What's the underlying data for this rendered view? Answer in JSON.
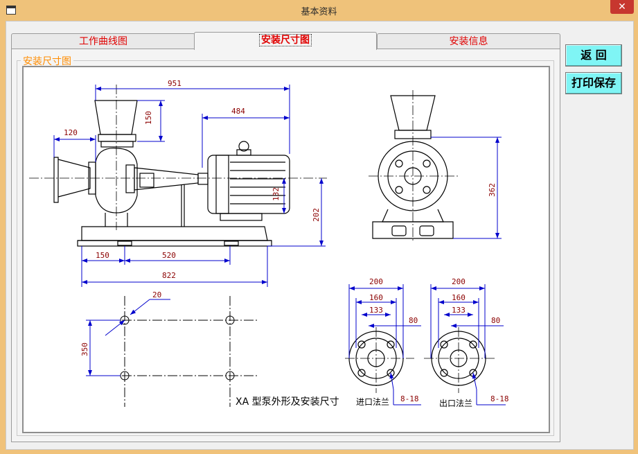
{
  "window": {
    "title": "基本资料",
    "close_glyph": "✕"
  },
  "tabs": [
    {
      "label": "工作曲线图",
      "active": false
    },
    {
      "label": "安装尺寸图",
      "active": true
    },
    {
      "label": "安装信息",
      "active": false
    }
  ],
  "group": {
    "label": "安装尺寸图"
  },
  "buttons": {
    "back": "返 回",
    "print_save": "打印保存"
  },
  "drawing": {
    "caption": "XA 型泵外形及安装尺寸",
    "inlet_flange": "进口法兰",
    "outlet_flange": "出口法兰",
    "dims": {
      "overall_length": "951",
      "motor_length": "484",
      "inlet_height": "150",
      "inlet_offset": "120",
      "shaft_height": "132",
      "center_height": "202",
      "base_left": "150",
      "base_bolt": "520",
      "base_length": "822",
      "outlet_height": "362",
      "bolt_hole": "20",
      "bolt_spacing": "350",
      "inlet_d1": "200",
      "inlet_d2": "160",
      "inlet_d3": "133",
      "inlet_d4": "80",
      "inlet_bolts": "8-18",
      "outlet_d1": "200",
      "outlet_d2": "160",
      "outlet_d3": "133",
      "outlet_d4": "80",
      "outlet_bolts": "8-18"
    },
    "colors": {
      "line": "#000000",
      "dim": "#0000cc",
      "dim_text": "#8b0000"
    }
  }
}
